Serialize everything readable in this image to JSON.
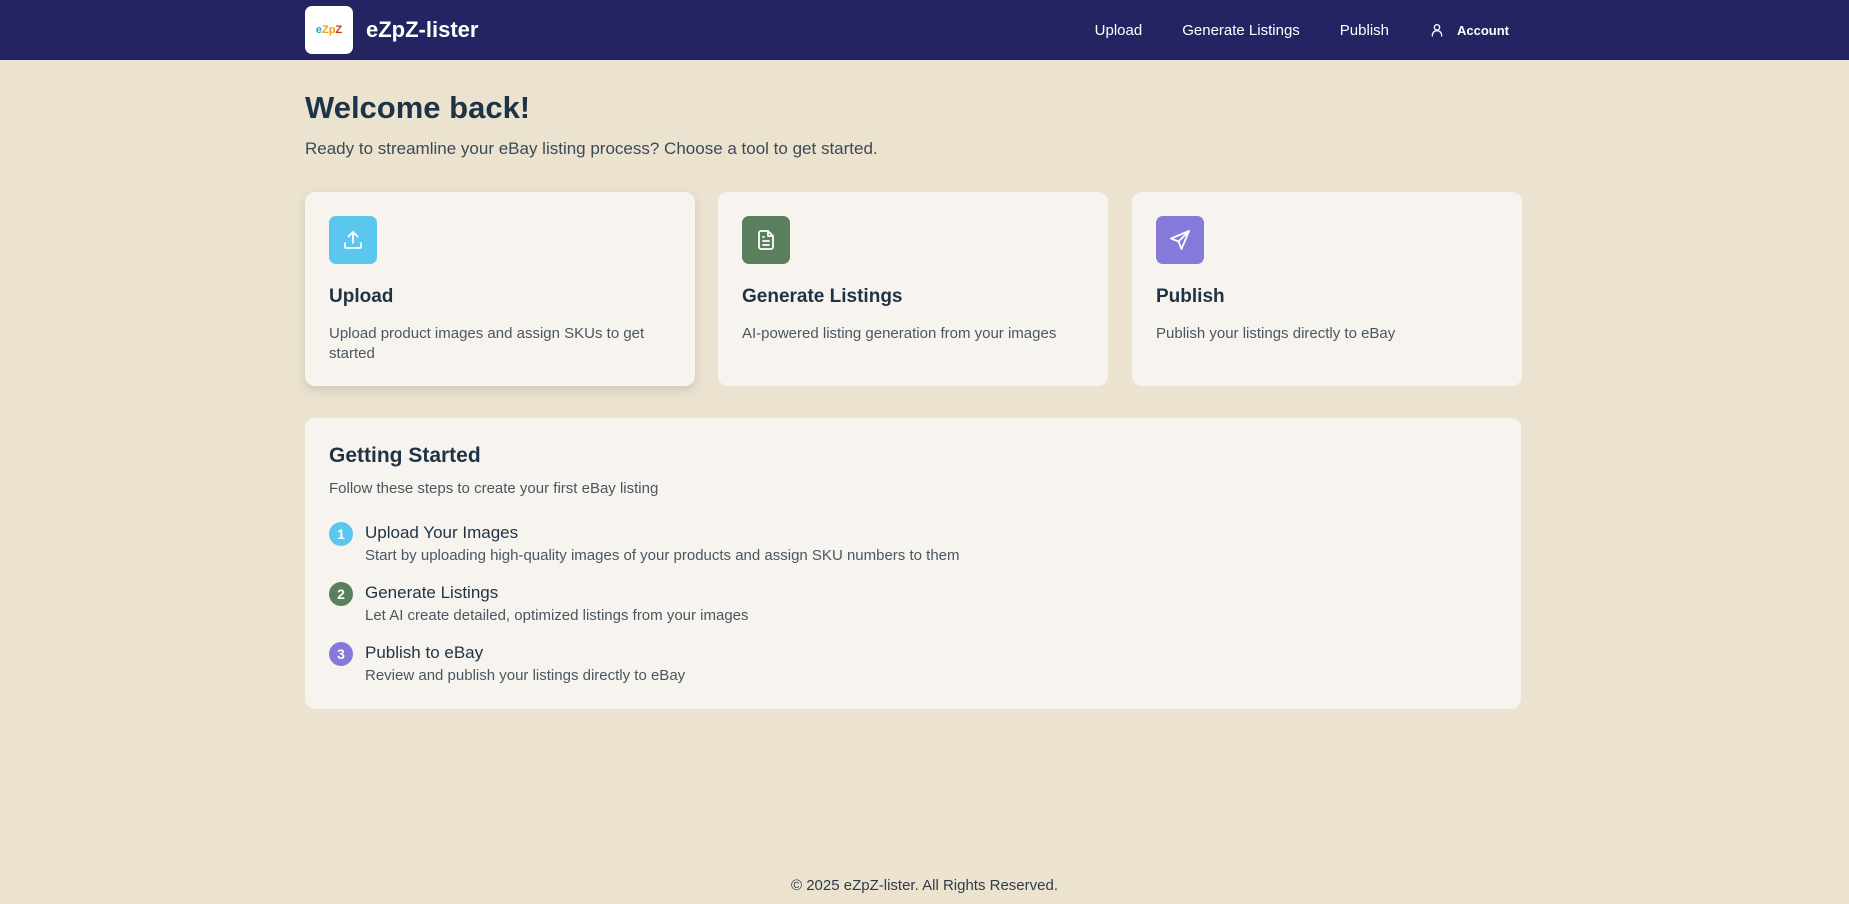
{
  "header": {
    "logo_text": [
      "e",
      "Zp",
      "Z"
    ],
    "brand": "eZpZ-lister",
    "nav": {
      "upload": "Upload",
      "generate": "Generate Listings",
      "publish": "Publish",
      "account": "Account"
    }
  },
  "welcome": {
    "title": "Welcome back!",
    "subtitle": "Ready to streamline your eBay listing process? Choose a tool to get started."
  },
  "cards": [
    {
      "title": "Upload",
      "desc": "Upload product images and assign SKUs to get started",
      "icon": "upload-icon",
      "color": "#5bc7ef"
    },
    {
      "title": "Generate Listings",
      "desc": "AI-powered listing generation from your images",
      "icon": "document-icon",
      "color": "#5a7f5c"
    },
    {
      "title": "Publish",
      "desc": "Publish your listings directly to eBay",
      "icon": "send-icon",
      "color": "#8579d9"
    }
  ],
  "getting_started": {
    "title": "Getting Started",
    "subtitle": "Follow these steps to create your first eBay listing",
    "steps": [
      {
        "num": "1",
        "title": "Upload Your Images",
        "desc": "Start by uploading high-quality images of your products and assign SKU numbers to them",
        "color": "#5bc7ef"
      },
      {
        "num": "2",
        "title": "Generate Listings",
        "desc": "Let AI create detailed, optimized listings from your images",
        "color": "#5a7f5c"
      },
      {
        "num": "3",
        "title": "Publish to eBay",
        "desc": "Review and publish your listings directly to eBay",
        "color": "#8579d9"
      }
    ]
  },
  "footer": {
    "text": "© 2025 eZpZ-lister. All Rights Reserved."
  }
}
